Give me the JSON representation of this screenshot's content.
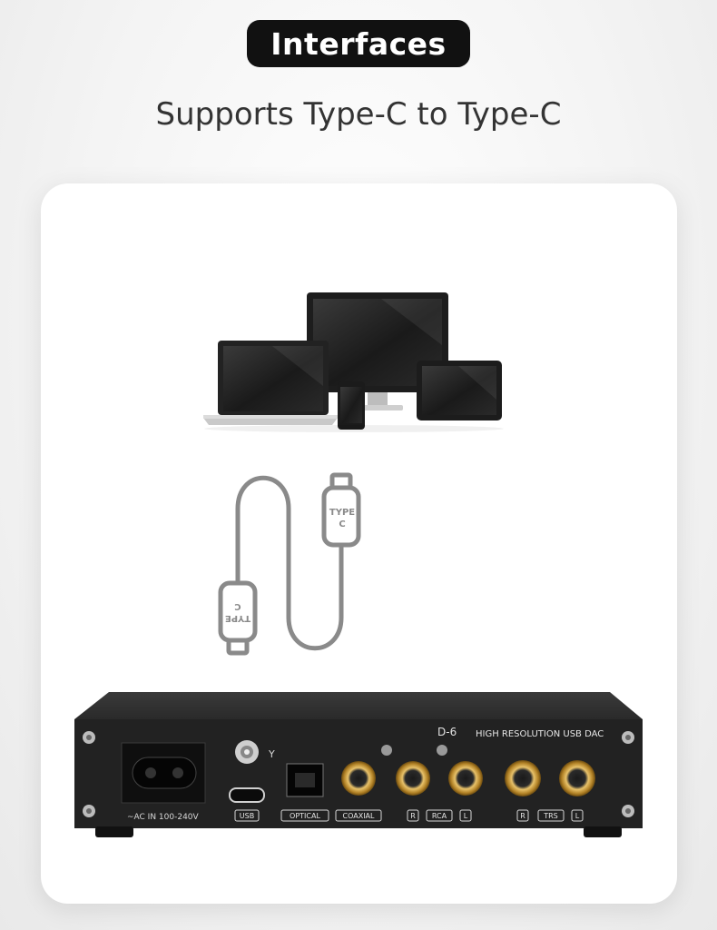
{
  "header": {
    "badge_label": "Interfaces",
    "subtitle": "Supports Type-C to Type-C"
  },
  "cable": {
    "plug_top_label_line1": "TYPE",
    "plug_top_label_line2": "C",
    "plug_bottom_label_line1": "TYPE",
    "plug_bottom_label_line2": "C"
  },
  "dac": {
    "model_mark": "D-6",
    "model_title": "HIGH RESOLUTION USB DAC",
    "ac_label": "~AC IN 100-240V",
    "usb_label": "USB",
    "optical_label": "OPTICAL",
    "coaxial_label": "COAXIAL",
    "rca_r": "R",
    "rca_label": "RCA",
    "rca_l": "L",
    "trs_r": "R",
    "trs_label": "TRS",
    "trs_l": "L",
    "antenna_symbol": "Y"
  },
  "icons": [
    "monitor-icon",
    "laptop-icon",
    "phone-icon",
    "tablet-icon",
    "usb-c-cable-icon",
    "dac-device-icon"
  ],
  "colors": {
    "badge_bg": "#111111",
    "card_bg": "#ffffff",
    "cable": "#8a8a8a",
    "dac_body": "#232323",
    "gold": "#c89a3a"
  }
}
